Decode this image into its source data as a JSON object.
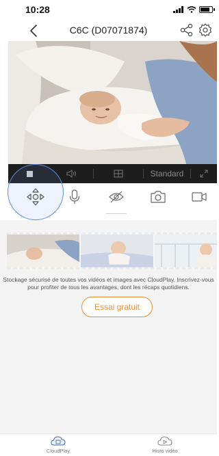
{
  "status_bar": {
    "time": "10:28"
  },
  "header": {
    "title": "C6C (D07071874)"
  },
  "video_toolbar": {
    "quality_label": "Standard"
  },
  "controls": [
    "ptz-icon",
    "microphone-icon",
    "privacy-icon",
    "camera-icon",
    "video-record-icon"
  ],
  "promo": {
    "text": "Stockage sécurisé de toutes vos vidéos et images avec CloudPlay. Inscrivez-vous pour profiter de tous les avantages, dont les récaps quotidiens.",
    "trial_button": "Essai gratuit"
  },
  "tabs": [
    {
      "label": "CloudPlay",
      "icon": "cloud-icon"
    },
    {
      "label": "Histo vidéo",
      "icon": "cloud-video-icon"
    }
  ],
  "colors": {
    "accent": "#f08a2e",
    "ptz_highlight": "#5b8fe6",
    "toolbar_bg": "#1d1d1d"
  }
}
